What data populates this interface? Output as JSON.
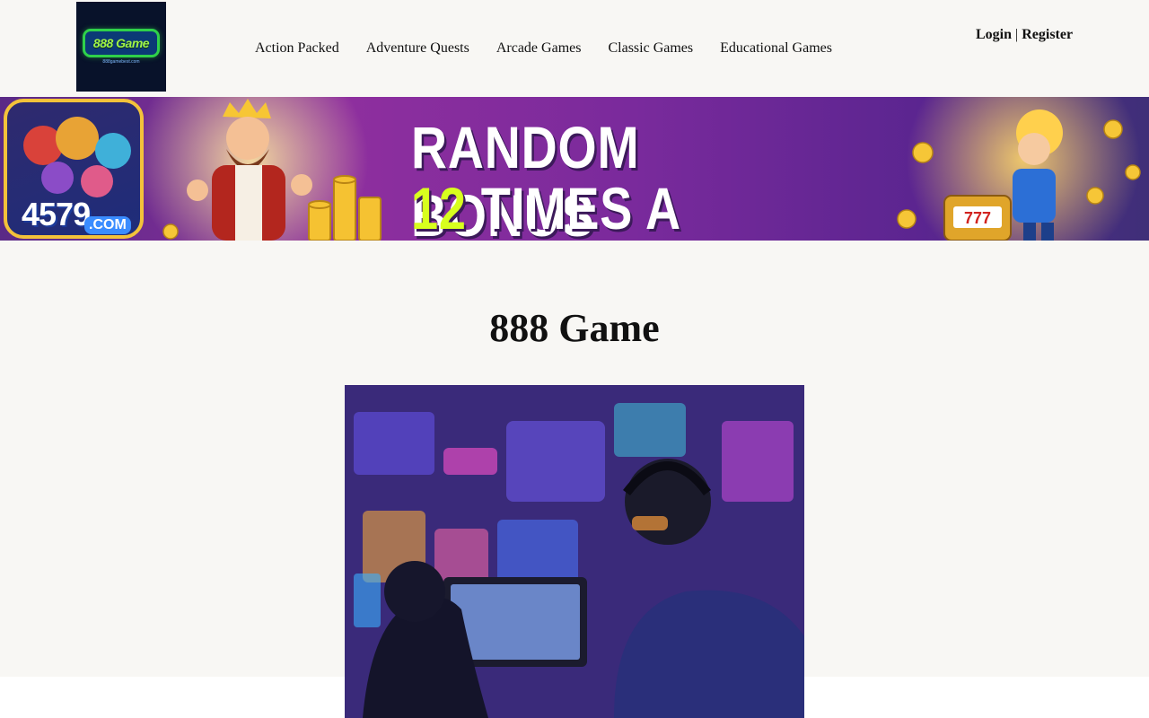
{
  "header": {
    "logo": {
      "text": "888 Game",
      "subtext": "888gamebest.com"
    },
    "nav": [
      "Action Packed",
      "Adventure Quests",
      "Arcade Games",
      "Classic Games",
      "Educational Games"
    ],
    "auth": {
      "login": "Login",
      "separator": "|",
      "register": "Register"
    }
  },
  "banner": {
    "line1": "RANDOM BONUS",
    "line2_accent": "12",
    "line2_rest": "TIMES A DAY",
    "badge_number": "4579",
    "badge_domain": ".COM",
    "colors": {
      "accent": "#d8ff1e",
      "purple": "#8e2f9e",
      "gold": "#f3c23a"
    }
  },
  "main": {
    "title": "888 Game"
  }
}
